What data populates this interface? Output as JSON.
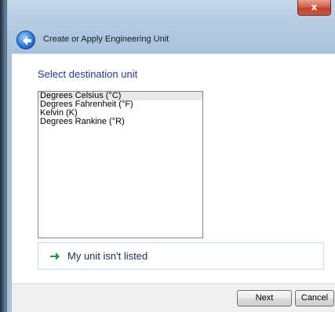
{
  "window": {
    "title": "Create or Apply Engineering Unit",
    "close_label": "x"
  },
  "main": {
    "heading": "Select destination unit",
    "units": [
      {
        "label": "Degrees Celsius (°C)",
        "selected": true
      },
      {
        "label": "Degrees Fahrenheit (°F)",
        "selected": false
      },
      {
        "label": "Kelvin (K)",
        "selected": false
      },
      {
        "label": "Degrees Rankine (°R)",
        "selected": false
      }
    ],
    "unlisted_label": "My unit isn't listed"
  },
  "footer": {
    "next_label": "Next",
    "cancel_label": "Cancel"
  },
  "colors": {
    "heading": "#1e3c96",
    "arrow": "#1f9e3a",
    "selected_row": "#e8e8e8"
  }
}
